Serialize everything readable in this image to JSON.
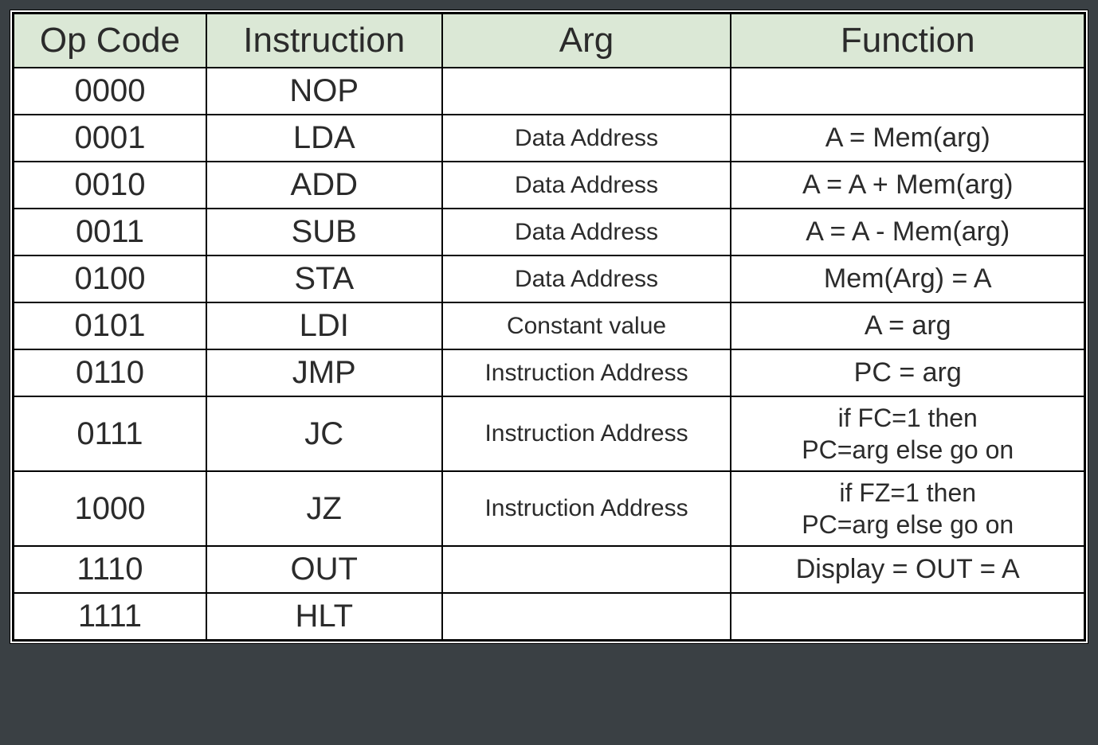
{
  "headers": {
    "opcode": "Op Code",
    "instruction": "Instruction",
    "arg": "Arg",
    "function": "Function"
  },
  "rows": [
    {
      "opcode": "0000",
      "instruction": "NOP",
      "arg": "",
      "function": ""
    },
    {
      "opcode": "0001",
      "instruction": "LDA",
      "arg": "Data Address",
      "function": "A = Mem(arg)"
    },
    {
      "opcode": "0010",
      "instruction": "ADD",
      "arg": "Data Address",
      "function": "A = A + Mem(arg)"
    },
    {
      "opcode": "0011",
      "instruction": "SUB",
      "arg": "Data Address",
      "function": "A = A - Mem(arg)"
    },
    {
      "opcode": "0100",
      "instruction": "STA",
      "arg": "Data Address",
      "function": "Mem(Arg) = A"
    },
    {
      "opcode": "0101",
      "instruction": "LDI",
      "arg": "Constant value",
      "function": "A = arg"
    },
    {
      "opcode": "0110",
      "instruction": "JMP",
      "arg": "Instruction Address",
      "function": "PC = arg"
    },
    {
      "opcode": "0111",
      "instruction": "JC",
      "arg": "Instruction Address",
      "function": "if FC=1 then\nPC=arg else go on"
    },
    {
      "opcode": "1000",
      "instruction": "JZ",
      "arg": "Instruction Address",
      "function": "if FZ=1 then\nPC=arg else go on"
    },
    {
      "opcode": "1110",
      "instruction": "OUT",
      "arg": "",
      "function": "Display = OUT = A"
    },
    {
      "opcode": "1111",
      "instruction": "HLT",
      "arg": "",
      "function": ""
    }
  ]
}
